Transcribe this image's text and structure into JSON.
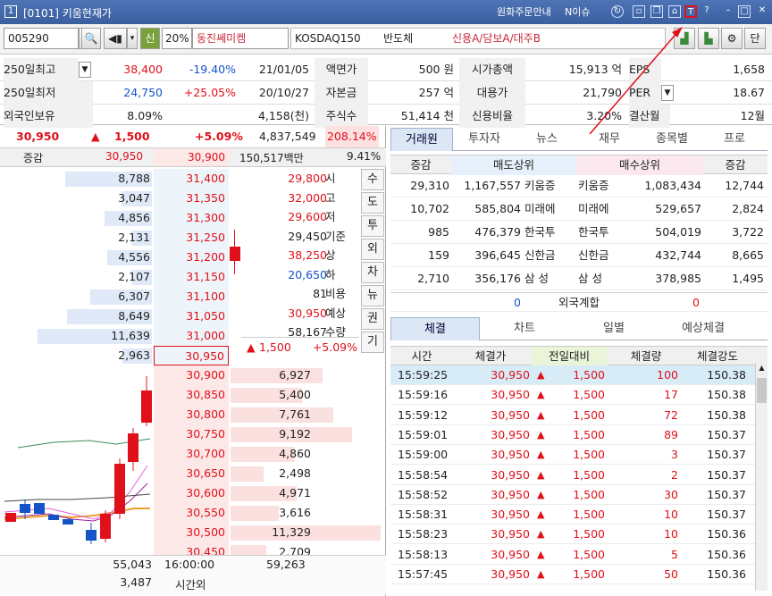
{
  "titlebar": {
    "num": "1",
    "title": "[0101] 키움현재가",
    "link1": "원화주문안내",
    "link2": "N이슈"
  },
  "toolbar": {
    "code": "005290",
    "credit": "신",
    "margin": "20%",
    "name": "동진쎄미켐",
    "market": "KOSDAQ150",
    "sector": "반도체",
    "flags": "신용A/담보A/대주B",
    "last_btn": "단"
  },
  "info": {
    "row1": [
      {
        "l": "250일최고",
        "v1": "38,400",
        "v2": "-19.40%",
        "v3": "21/01/05"
      },
      {
        "l": "액면가",
        "v": "500 원"
      },
      {
        "l": "시가총액",
        "v": "15,913 억"
      },
      {
        "l": "EPS",
        "v": "1,658"
      }
    ],
    "row2": [
      {
        "l": "250일최저",
        "v1": "24,750",
        "v2": "+25.05%",
        "v3": "20/10/27"
      },
      {
        "l": "자본금",
        "v": "257 억"
      },
      {
        "l": "대용가",
        "v": "21,790"
      },
      {
        "l": "PER",
        "v": "18.67"
      }
    ],
    "row3": [
      {
        "l": "외국인보유",
        "v1": "8.09%",
        "v3": "4,158(천)"
      },
      {
        "l": "주식수",
        "v": "51,414 천"
      },
      {
        "l": "신용비율",
        "v": "3.20%"
      },
      {
        "l": "결산월",
        "v": "12월"
      }
    ]
  },
  "summary": {
    "price": "30,950",
    "arrow": "▲",
    "change": "1,500",
    "rate": "+5.09%",
    "volume": "4,837,549",
    "turnover": "208.14%"
  },
  "header2": {
    "label": "증감",
    "p1": "30,950",
    "p2": "30,900",
    "amt": "150,517백만",
    "pct": "9.41%"
  },
  "asks": [
    {
      "qty": "8,788",
      "price": "31,400"
    },
    {
      "qty": "3,047",
      "price": "31,350"
    },
    {
      "qty": "4,856",
      "price": "31,300"
    },
    {
      "qty": "2,131",
      "price": "31,250"
    },
    {
      "qty": "4,556",
      "price": "31,200"
    },
    {
      "qty": "2,107",
      "price": "31,150"
    },
    {
      "qty": "6,307",
      "price": "31,100"
    },
    {
      "qty": "8,649",
      "price": "31,050"
    },
    {
      "qty": "11,639",
      "price": "31,000"
    },
    {
      "qty": "2,963",
      "price": "30,950"
    }
  ],
  "bids": [
    {
      "price": "30,900",
      "qty": "6,927"
    },
    {
      "price": "30,850",
      "qty": "5,400"
    },
    {
      "price": "30,800",
      "qty": "7,761"
    },
    {
      "price": "30,750",
      "qty": "9,192"
    },
    {
      "price": "30,700",
      "qty": "4,860"
    },
    {
      "price": "30,650",
      "qty": "2,498"
    },
    {
      "price": "30,600",
      "qty": "4,971"
    },
    {
      "price": "30,550",
      "qty": "3,616"
    },
    {
      "price": "30,500",
      "qty": "11,329"
    },
    {
      "price": "30,450",
      "qty": "2,709"
    }
  ],
  "stats": [
    {
      "v": "29,800",
      "l": "시",
      "c": "red"
    },
    {
      "v": "32,000",
      "l": "고",
      "c": "red"
    },
    {
      "v": "29,600",
      "l": "저",
      "c": "red"
    },
    {
      "v": "29,450",
      "l": "기준",
      "c": ""
    },
    {
      "v": "38,250",
      "l": "상",
      "c": "red"
    },
    {
      "v": "20,650",
      "l": "하",
      "c": "blue"
    },
    {
      "v": "81",
      "l": "비용",
      "c": ""
    },
    {
      "v": "30,950",
      "l": "예상",
      "c": "red"
    },
    {
      "v": "58,167",
      "l": "수량",
      "c": ""
    }
  ],
  "expected": {
    "arrow": "▲",
    "chg": "1,500",
    "rate": "+5.09%"
  },
  "side_buttons": [
    "수",
    "도",
    "투",
    "외",
    "차",
    "뉴",
    "권",
    "기"
  ],
  "footer": {
    "ask_total": "55,043",
    "time": "16:00:00",
    "bid_total": "59,263",
    "after_qty": "3,487",
    "after_label": "시간외"
  },
  "right_tabs": [
    "거래원",
    "투자자",
    "뉴스",
    "재무",
    "종목별",
    "프로"
  ],
  "broker_head": {
    "h1": "증감",
    "h2": "매도상위",
    "h3": "매수상위",
    "h4": "증감"
  },
  "brokers": [
    {
      "d1": "29,310",
      "sq": "1,167,557",
      "sn": "키움증",
      "bn": "키움증",
      "bq": "1,083,434",
      "d2": "12,744"
    },
    {
      "d1": "10,702",
      "sq": "585,804",
      "sn": "미래에",
      "bn": "미래에",
      "bq": "529,657",
      "d2": "2,824"
    },
    {
      "d1": "985",
      "sq": "476,379",
      "sn": "한국투",
      "bn": "한국투",
      "bq": "504,019",
      "d2": "3,722"
    },
    {
      "d1": "159",
      "sq": "396,645",
      "sn": "신한금",
      "bn": "신한금",
      "bq": "432,744",
      "d2": "8,665"
    },
    {
      "d1": "2,710",
      "sq": "356,176",
      "sn": "삼 성",
      "bn": "삼 성",
      "bq": "378,985",
      "d2": "1,495"
    }
  ],
  "foreign": {
    "l": "0",
    "label": "외국계합",
    "r": "0"
  },
  "trade_tabs": [
    "체결",
    "차트",
    "일별",
    "예상체결"
  ],
  "trade_head": [
    "시간",
    "체결가",
    "전일대비",
    "체결량",
    "체결강도"
  ],
  "trades": [
    {
      "t": "15:59:25",
      "p": "30,950",
      "c": "1,500",
      "q": "100",
      "s": "150.38"
    },
    {
      "t": "15:59:16",
      "p": "30,950",
      "c": "1,500",
      "q": "17",
      "s": "150.38"
    },
    {
      "t": "15:59:12",
      "p": "30,950",
      "c": "1,500",
      "q": "72",
      "s": "150.38"
    },
    {
      "t": "15:59:01",
      "p": "30,950",
      "c": "1,500",
      "q": "89",
      "s": "150.37"
    },
    {
      "t": "15:59:00",
      "p": "30,950",
      "c": "1,500",
      "q": "3",
      "s": "150.37"
    },
    {
      "t": "15:58:54",
      "p": "30,950",
      "c": "1,500",
      "q": "2",
      "s": "150.37"
    },
    {
      "t": "15:58:52",
      "p": "30,950",
      "c": "1,500",
      "q": "30",
      "s": "150.37"
    },
    {
      "t": "15:58:31",
      "p": "30,950",
      "c": "1,500",
      "q": "10",
      "s": "150.37"
    },
    {
      "t": "15:58:23",
      "p": "30,950",
      "c": "1,500",
      "q": "10",
      "s": "150.36"
    },
    {
      "t": "15:58:13",
      "p": "30,950",
      "c": "1,500",
      "q": "5",
      "s": "150.36"
    },
    {
      "t": "15:57:45",
      "p": "30,950",
      "c": "1,500",
      "q": "50",
      "s": "150.36"
    }
  ],
  "colors": {
    "up": "#e0101a",
    "down": "#1553c8",
    "titlebar": "#3a5f9f"
  }
}
